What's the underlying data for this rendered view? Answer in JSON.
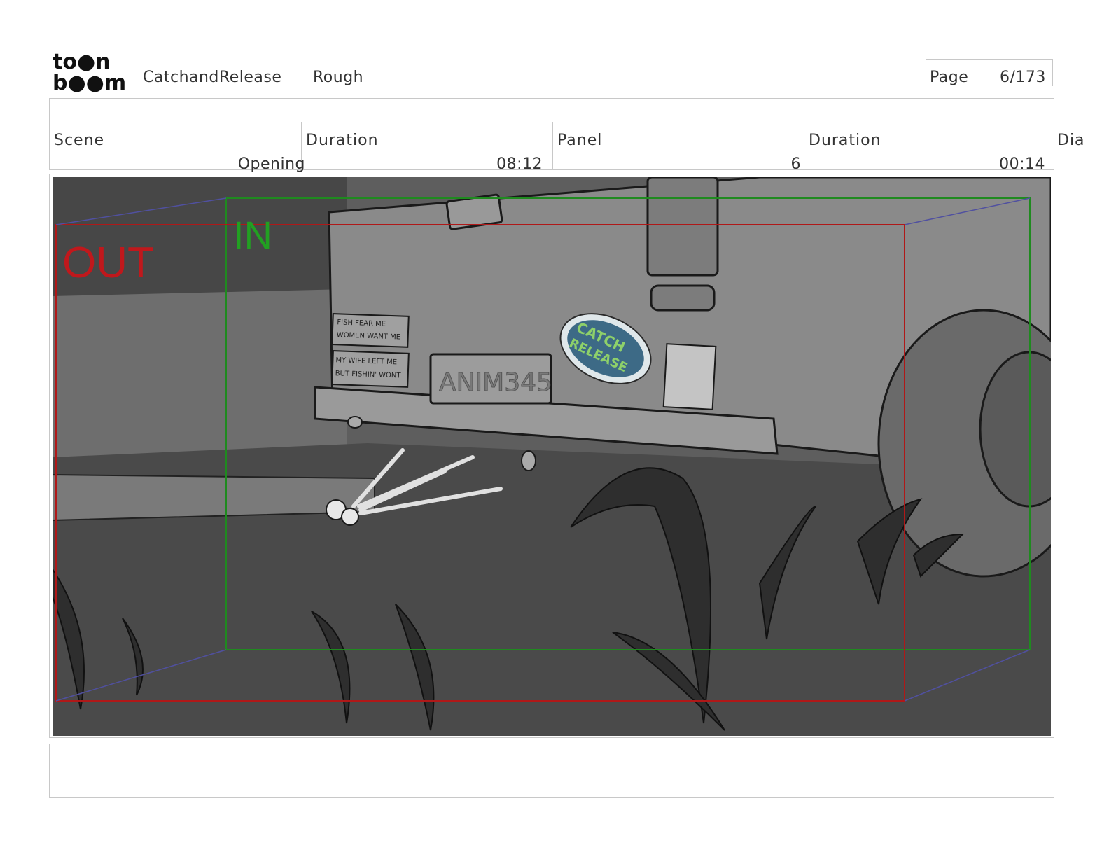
{
  "header": {
    "logo_line1": "to●n",
    "logo_line2": "b●●m",
    "project": "CatchandRelease",
    "stage": "Rough",
    "page_label": "Page",
    "page_value": "6/173"
  },
  "info": {
    "scene_label": "Scene",
    "scene_value": "Opening",
    "scene_duration_label": "Duration",
    "scene_duration_value": "08:12",
    "panel_label": "Panel",
    "panel_value": "6",
    "panel_duration_label": "Duration",
    "panel_duration_value": "00:14",
    "dialogue_label": "Dia"
  },
  "panel": {
    "out_marker": "OUT",
    "in_marker": "IN",
    "sticker_1_line1": "FISH FEAR ME",
    "sticker_1_line2": "WOMEN WANT ME",
    "sticker_2_line1": "MY WIFE LEFT ME",
    "sticker_2_line2": "BUT FISHIN' WONT",
    "license_plate": "ANIM345",
    "logo_sticker_line1": "CATCH",
    "logo_sticker_line2": "RELEASE",
    "out_color": "#c0181c",
    "in_color": "#22a022"
  }
}
